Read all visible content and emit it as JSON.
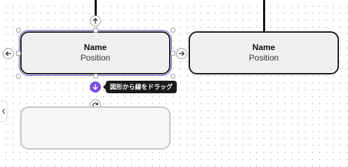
{
  "nodes": [
    {
      "name": "Name",
      "position": "Position",
      "selected": true
    },
    {
      "name": "Name",
      "position": "Position",
      "selected": false
    }
  ],
  "tooltip": {
    "text": "図形から線をドラッグ"
  },
  "icons": {
    "add_above": "arrow-up-icon",
    "add_left": "arrow-left-icon",
    "add_right": "arrow-right-icon",
    "drag_connector": "arrow-down-icon",
    "rotate": "rotate-icon",
    "panel_toggle": "chevron-left-icon"
  },
  "colors": {
    "accent": "#7b4fe0",
    "selection": "#6d4bd8",
    "card_fill": "#efefef",
    "card_border": "#1a1a1a",
    "tooltip_bg": "#1b1b1b"
  }
}
